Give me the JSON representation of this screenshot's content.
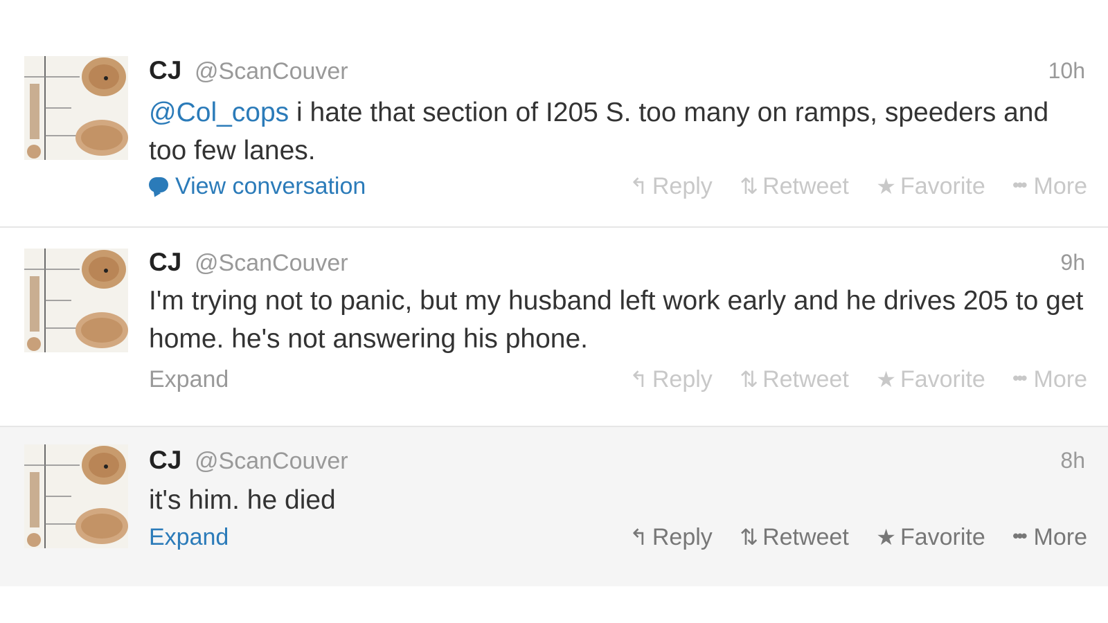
{
  "tweets": [
    {
      "name": "CJ",
      "handle": "@ScanCouver",
      "time": "10h",
      "mention": "@Col_cops",
      "text": " i hate that section of I205 S. too many on ramps, speeders and too few lanes.",
      "footer_link": "View conversation",
      "actions": {
        "reply": "Reply",
        "retweet": "Retweet",
        "favorite": "Favorite",
        "more": "More"
      }
    },
    {
      "name": "CJ",
      "handle": "@ScanCouver",
      "time": "9h",
      "text": "I'm trying not to panic, but my husband left work early and he drives 205 to get home. he's not answering his phone.",
      "footer_link": "Expand",
      "actions": {
        "reply": "Reply",
        "retweet": "Retweet",
        "favorite": "Favorite",
        "more": "More"
      }
    },
    {
      "name": "CJ",
      "handle": "@ScanCouver",
      "time": "8h",
      "text": "it's him. he died",
      "footer_link": "Expand",
      "actions": {
        "reply": "Reply",
        "retweet": "Retweet",
        "favorite": "Favorite",
        "more": "More"
      }
    }
  ],
  "icons": {
    "conversation": "speech-bubble-icon",
    "reply": "reply-arrow-icon",
    "retweet": "retweet-icon",
    "favorite": "star-icon",
    "more": "more-dots-icon"
  },
  "colors": {
    "link": "#2b7bb9",
    "highlighted_row": "#f5f5f5",
    "muted": "#999999"
  }
}
